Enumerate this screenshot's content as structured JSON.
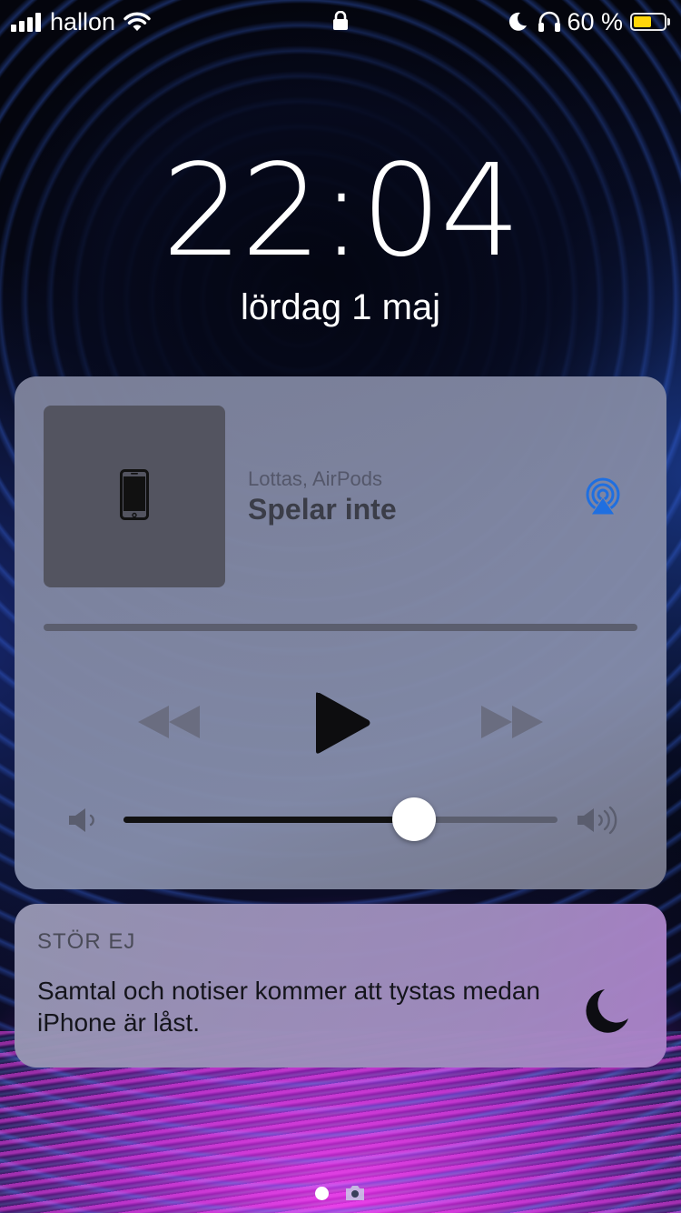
{
  "status_bar": {
    "carrier": "hallon",
    "battery_percent": "60 %",
    "battery_level": 0.6,
    "signal_bars": 4,
    "icons": [
      "signal-icon",
      "wifi-icon",
      "lock-icon",
      "moon-icon",
      "headphones-icon",
      "battery-icon"
    ]
  },
  "lock_screen": {
    "time": "22:04",
    "date": "lördag 1 maj"
  },
  "now_playing": {
    "subtitle": "Lottas, AirPods",
    "title": "Spelar inte",
    "artwork_icon": "iphone-icon",
    "airplay_icon": "airplay-icon",
    "volume_level": 0.67,
    "colors": {
      "airplay": "#1f6fe0"
    }
  },
  "dnd": {
    "header": "STÖR EJ",
    "message": "Samtal och notiser kommer att tystas medan iPhone är låst.",
    "icon": "moon-icon"
  },
  "bottom": {
    "icons": [
      "page-dot",
      "camera-icon"
    ]
  }
}
